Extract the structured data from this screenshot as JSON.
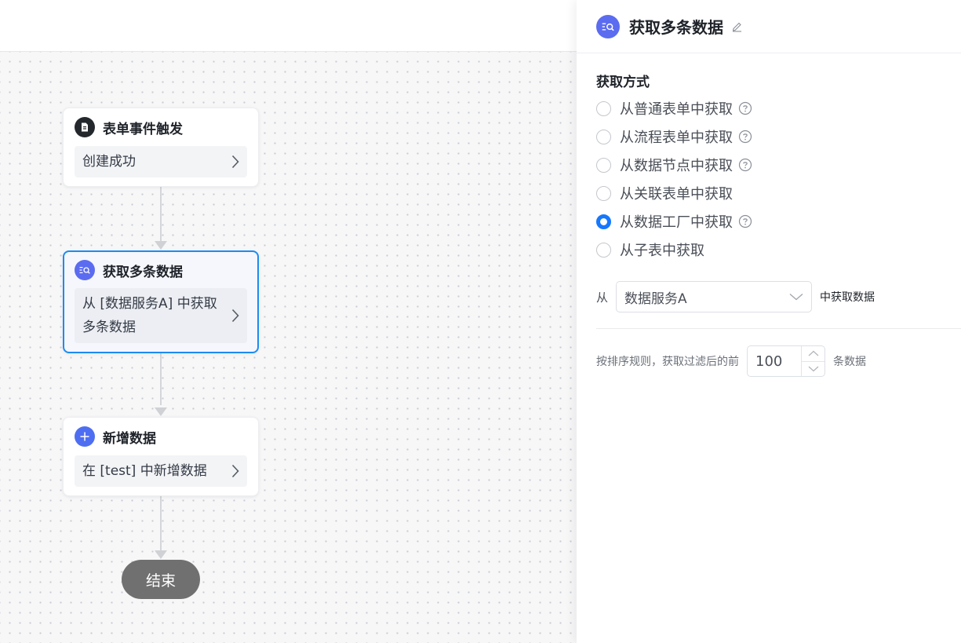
{
  "flow": {
    "nodes": [
      {
        "title": "表单事件触发",
        "body": "创建成功",
        "icon": "form-document-icon",
        "icon_bg": "#24282d"
      },
      {
        "title": "获取多条数据",
        "body": "从 [数据服务A] 中获取多条数据",
        "icon": "query-list-icon",
        "icon_bg": "#5b6cf0",
        "selected": true
      },
      {
        "title": "新增数据",
        "body": "在 [test] 中新增数据",
        "icon": "plus-icon",
        "icon_bg": "#4e6ef2"
      }
    ],
    "end_label": "结束"
  },
  "panel": {
    "title": "获取多条数据",
    "section_label": "获取方式",
    "options": [
      {
        "label": "从普通表单中获取",
        "help": true,
        "checked": false
      },
      {
        "label": "从流程表单中获取",
        "help": true,
        "checked": false
      },
      {
        "label": "从数据节点中获取",
        "help": true,
        "checked": false
      },
      {
        "label": "从关联表单中获取",
        "help": false,
        "checked": false
      },
      {
        "label": "从数据工厂中获取",
        "help": true,
        "checked": true
      },
      {
        "label": "从子表中获取",
        "help": false,
        "checked": false
      }
    ],
    "from_label": "从",
    "source_value": "数据服务A",
    "from_suffix": "中获取数据",
    "limit_prefix": "按排序规则，获取过滤后的前",
    "limit_value": "100",
    "limit_suffix": "条数据"
  },
  "colors": {
    "accent": "#1677ff",
    "selected_border": "#1d8cf0",
    "end_node": "#707070"
  }
}
